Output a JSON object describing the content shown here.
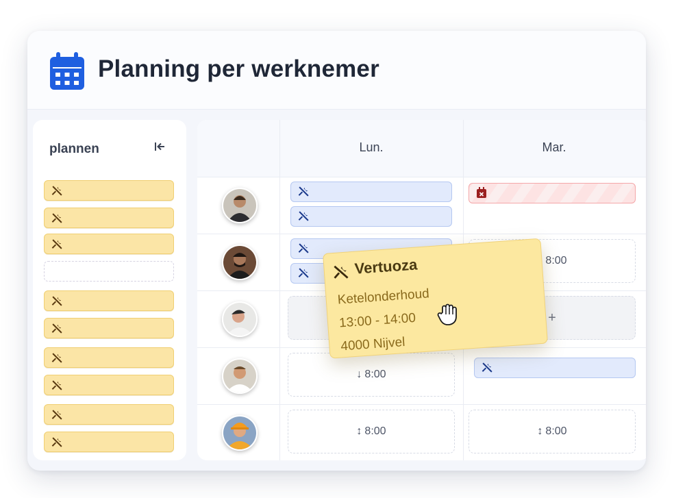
{
  "header": {
    "title": "Planning per werknemer",
    "icon": "calendar-icon"
  },
  "sidebar": {
    "title": "plannen",
    "collapse_icon": "collapse-left-icon",
    "items": [
      {
        "type": "task",
        "icon": "tools-icon"
      },
      {
        "type": "task",
        "icon": "tools-icon"
      },
      {
        "type": "task",
        "icon": "tools-icon"
      },
      {
        "type": "empty"
      },
      {
        "type": "task",
        "icon": "tools-icon"
      },
      {
        "type": "task",
        "icon": "tools-icon"
      },
      {
        "type": "task",
        "icon": "tools-icon"
      },
      {
        "type": "task",
        "icon": "tools-icon"
      },
      {
        "type": "task",
        "icon": "tools-icon"
      },
      {
        "type": "task",
        "icon": "tools-icon"
      }
    ]
  },
  "grid": {
    "days": [
      "Lun.",
      "Mar."
    ],
    "slots": {
      "row2_mar": "8:00",
      "row3_mar": "+",
      "row4_lun": "8:00",
      "row5_lun": "8:00",
      "row5_mar": "8:00"
    }
  },
  "tooltip": {
    "title": "Vertuoza",
    "service": "Ketelonderhoud",
    "time": "13:00 - 14:00",
    "location": "4000 Nijvel"
  },
  "colors": {
    "accent": "#1f5fe0",
    "task_yellow": "#fbe5a6",
    "task_blue": "#e2eafc",
    "absence_red": "#f4a6a8"
  }
}
